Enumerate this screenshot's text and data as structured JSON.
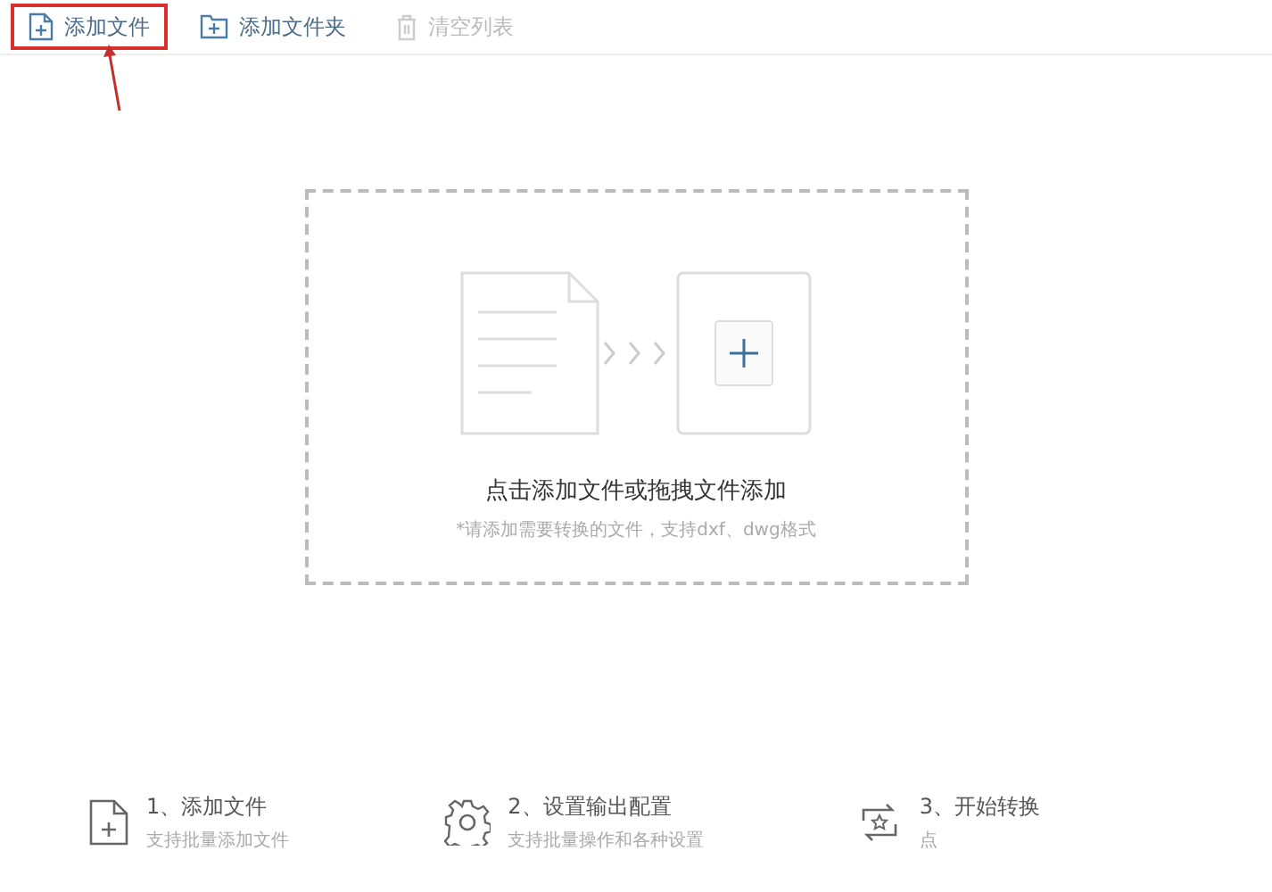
{
  "toolbar": {
    "items": [
      {
        "kind": "file",
        "label": "添加文件",
        "disabled": false,
        "highlighted": true
      },
      {
        "kind": "folder",
        "label": "添加文件夹",
        "disabled": false,
        "highlighted": false
      },
      {
        "kind": "trash",
        "label": "清空列表",
        "disabled": true,
        "highlighted": false
      }
    ]
  },
  "drop_zone": {
    "title": "点击添加文件或拖拽文件添加",
    "hint": "*请添加需要转换的文件，支持dxf、dwg格式"
  },
  "steps": [
    {
      "kind": "file",
      "title": "1、添加文件",
      "subtitle": "支持批量添加文件"
    },
    {
      "kind": "gear",
      "title": "2、设置输出配置",
      "subtitle": "支持批量操作和各种设置"
    },
    {
      "kind": "convert",
      "title": "3、开始转换",
      "subtitle": "点"
    }
  ]
}
